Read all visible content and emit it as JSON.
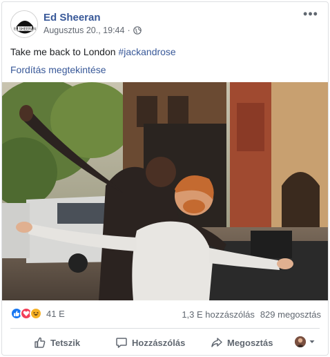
{
  "post": {
    "author": "Ed Sheeran",
    "avatar_text": "Ed SHEERAN",
    "timestamp": "Augusztus 20., 19:44",
    "audience_icon": "globe-icon",
    "text_plain": "Take me back to London ",
    "hashtag": "#jackandrose",
    "translate_label": "Fordítás megtekintése"
  },
  "stats": {
    "reaction_count": "41 E",
    "reactions": [
      "like-icon",
      "love-icon",
      "haha-icon"
    ],
    "comments": "1,3 E hozzászólás",
    "shares": "829 megosztás"
  },
  "actions": {
    "like_label": "Tetszik",
    "comment_label": "Hozzászólás",
    "share_label": "Megosztás"
  },
  "colors": {
    "link": "#385898",
    "muted": "#606770",
    "like_blue": "#1877f2",
    "love_red": "#f33e58",
    "haha_yellow": "#f7b125"
  }
}
